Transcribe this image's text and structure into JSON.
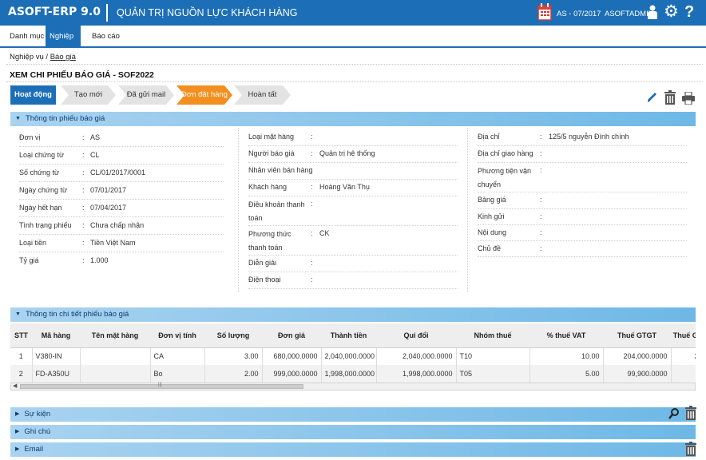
{
  "app": {
    "brand": "ASOFT-ERP 9.0",
    "module": "QUẢN TRỊ NGUỒN LỰC KHÁCH HÀNG",
    "period": "AS - 07/2017",
    "user": "ASOFTADMIN",
    "help": "?"
  },
  "menu": [
    "Danh mục",
    "Nghiệp vụ",
    "Báo cáo"
  ],
  "breadcrumb": {
    "root": "Nghiệp vụ /",
    "current": "Báo giá"
  },
  "page_title": "XEM CHI PHIẾU BÁO GIÁ - SOF2022",
  "steps": [
    "Hoạt động",
    "Tạo mới",
    "Đã gửi mail",
    "Đơn đặt hàng",
    "Hoàn tất"
  ],
  "icons": {
    "calendar": "calendar-icon",
    "user": "user-icon",
    "gear": "gear-icon",
    "help": "help-icon",
    "edit": "pencil-icon",
    "delete": "trash-icon",
    "print": "printer-icon",
    "search": "magnifier-icon"
  },
  "colors": {
    "header": "#1c6fb7",
    "active_step": "#f28f1e",
    "section": "#6eb8e6"
  },
  "section_info": "Thông tin phiếu báo giá",
  "col1": [
    {
      "label": "Đơn vị",
      "value": "AS"
    },
    {
      "label": "Loại chứng từ",
      "value": "CL"
    },
    {
      "label": "Số chứng từ",
      "value": "CL/01/2017/0001"
    },
    {
      "label": "Ngày chứng từ",
      "value": "07/01/2017"
    },
    {
      "label": "Ngày hết hạn",
      "value": "07/04/2017"
    },
    {
      "label": "Tình trạng phiếu",
      "value": "Chưa chấp nhận"
    },
    {
      "label": "Loại tiền",
      "value": "Tiền Việt Nam"
    },
    {
      "label": "Tỷ giá",
      "value": "1.000"
    }
  ],
  "col2": [
    {
      "label": "Loại mặt hàng",
      "value": ""
    },
    {
      "label": "Người báo giá",
      "value": "Quản trị hệ thống"
    },
    {
      "label": "Nhân viên bán hàng",
      "value": ""
    },
    {
      "label": "Khách hàng",
      "value": "Hoàng Văn Thụ"
    },
    {
      "label": "Điều khoản thanh toán",
      "value": ""
    },
    {
      "label": "Phương thức thanh toán",
      "value": "CK"
    },
    {
      "label": "Diễn giải",
      "value": ""
    },
    {
      "label": "Điện thoại",
      "value": ""
    }
  ],
  "col3": [
    {
      "label": "Địa chỉ",
      "value": "125/5 nguyễn Đình chính"
    },
    {
      "label": "Địa chỉ giao hàng",
      "value": ""
    },
    {
      "label": "Phương tiện vận chuyển",
      "value": ""
    },
    {
      "label": "Bảng giá",
      "value": ""
    },
    {
      "label": "Kinh gửi",
      "value": ""
    },
    {
      "label": "Nội dung",
      "value": ""
    },
    {
      "label": "Chủ đề",
      "value": ""
    }
  ],
  "colon": ":",
  "section_detail": "Thông tin chi tiết phiếu báo giá",
  "table": {
    "headers": [
      "STT",
      "Mã hàng",
      "Tên mặt hàng",
      "Đơn vị tính",
      "Số lượng",
      "Đơn giá",
      "Thành tiền",
      "Qui đổi",
      "Nhóm thuế",
      "% thuế VAT",
      "Thuế GTGT",
      "Thuế GTG"
    ],
    "rows": [
      [
        "1",
        "V380-IN",
        "",
        "CA",
        "3.00",
        "680,000.0000",
        "2,040,000.0000",
        "2,040,000.0000",
        "T10",
        "10.00",
        "204,000.0000",
        "204"
      ],
      [
        "2",
        "FD-A350U",
        "",
        "Bo",
        "2.00",
        "999,000.0000",
        "1,998,000.0000",
        "1,998,000.0000",
        "T05",
        "5.00",
        "99,900.0000",
        "99"
      ]
    ]
  },
  "scroll_grip": "|||",
  "sections_bottom": [
    "Sự kiện",
    "Ghi chú",
    "Email"
  ]
}
